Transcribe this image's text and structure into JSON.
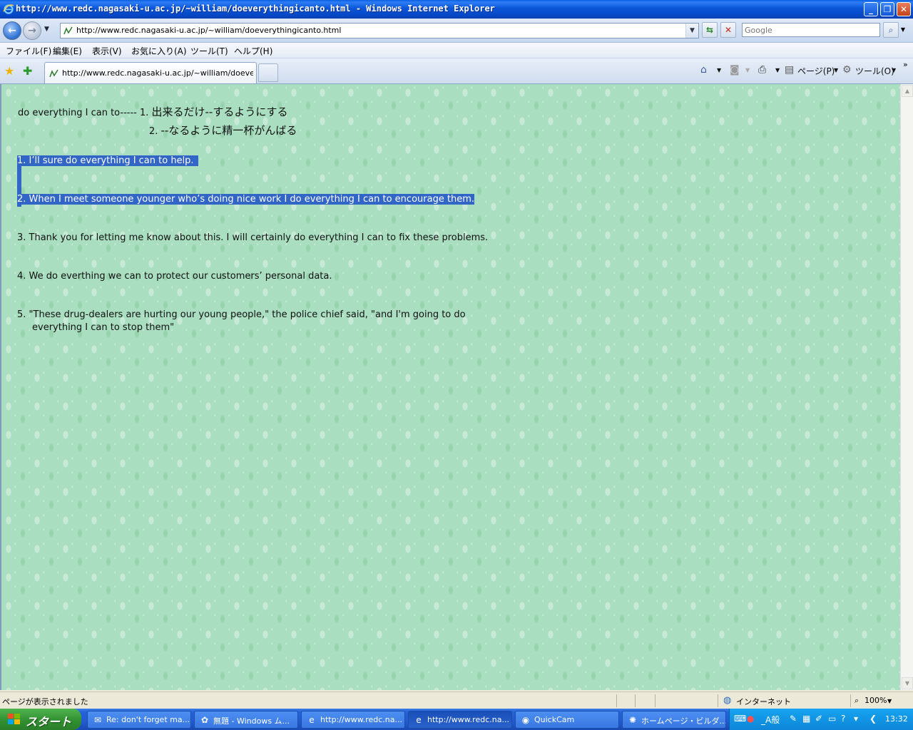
{
  "window": {
    "title": "http://www.redc.nagasaki-u.ac.jp/~william/doeverythingicanto.html - Windows Internet Explorer",
    "minimize_label": "_",
    "restore_label": "❐",
    "close_label": "✕"
  },
  "address": {
    "url": "http://www.redc.nagasaki-u.ac.jp/~william/doeverythingicanto.html",
    "search_placeholder": "Google"
  },
  "menu": {
    "file": "ファイル(F)",
    "edit": "編集(E)",
    "view": "表示(V)",
    "favorites": "お気に入り(A)",
    "tools": "ツール(T)",
    "help": "ヘルプ(H)"
  },
  "tabs": {
    "active_label": "http://www.redc.nagasaki-u.ac.jp/~william/doeveryt..."
  },
  "commandbar": {
    "page": "ページ(P)",
    "tools": "ツール(O)"
  },
  "page": {
    "definition_head": "do everything I can to----- 1. ",
    "definition_1": "出来るだけ--するようにする",
    "definition_2_num": "2. ",
    "definition_2": "--なるように精一杯がんばる",
    "example_1": "1. I’ll sure do everything I can to help.",
    "example_2": "2. When I meet someone younger who’s doing nice work I do everything I can to encourage them.",
    "example_3": "3. Thank you for letting me know about this. I will certainly do everything I can to fix these problems.",
    "example_4": "4. We do everthing we can to protect our customers’ personal data.",
    "example_5_line1": "5. \"These drug-dealers are hurting our young people,\" the police chief said, \"and I'm going to do",
    "example_5_line2": "everything I can to stop them\""
  },
  "status": {
    "message": "ページが表示されました",
    "zone": "インターネット",
    "zoom": "100%"
  },
  "taskbar": {
    "start_label": "スタート",
    "tasks": [
      "Re: don't forget ma...",
      "無題 - Windows ム...",
      "http://www.redc.na...",
      "http://www.redc.na...",
      "QuickCam",
      "ホームページ・ビルダ..."
    ],
    "tray_ime": "_A般",
    "clock": "13:32"
  }
}
